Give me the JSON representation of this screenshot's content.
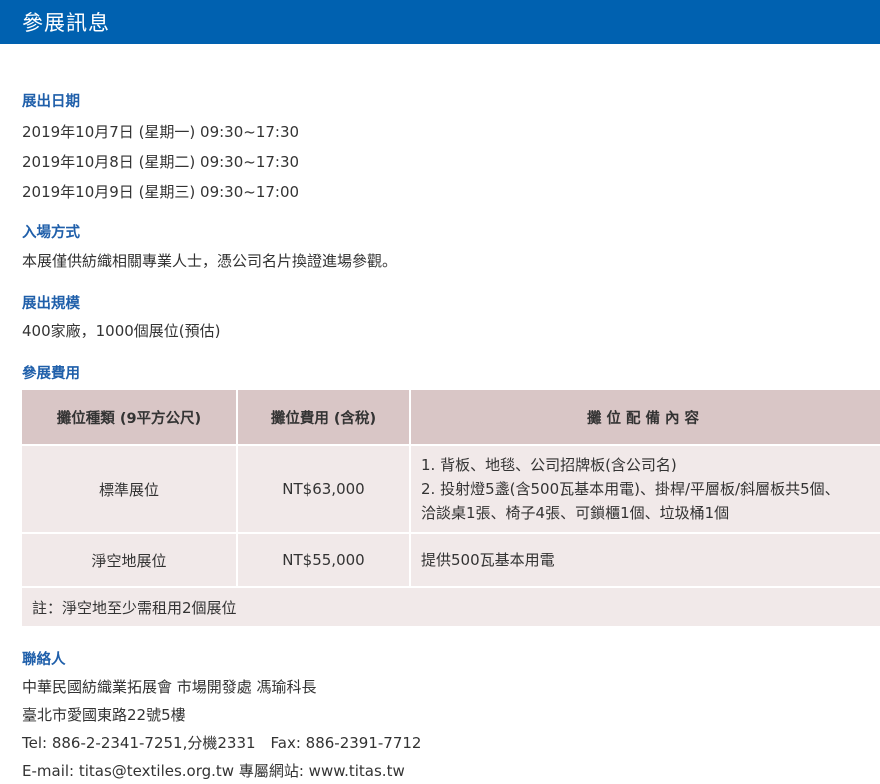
{
  "header": {
    "title": "參展訊息"
  },
  "dates": {
    "title": "展出日期",
    "lines": [
      "2019年10月7日 (星期一) 09:30~17:30",
      "2019年10月8日 (星期二) 09:30~17:30",
      "2019年10月9日 (星期三) 09:30~17:00"
    ]
  },
  "entry": {
    "title": "入場方式",
    "text": "本展僅供紡織相關專業人士，憑公司名片換證進場參觀。"
  },
  "scale": {
    "title": "展出規模",
    "text": "400家廠，1000個展位(預估)"
  },
  "fees": {
    "title": "參展費用",
    "headers": [
      "攤位種類 (9平方公尺)",
      "攤位費用 (含稅)",
      "攤位配備內容"
    ],
    "rows": [
      {
        "type": "標準展位",
        "price": "NT$63,000",
        "items": [
          "1. 背板、地毯、公司招牌板(含公司名)",
          "2. 投射燈5盞(含500瓦基本用電)、掛桿/平層板/斜層板共5個、",
          "洽談桌1張、椅子4張、可鎖櫃1個、垃圾桶1個"
        ]
      },
      {
        "type": "淨空地展位",
        "price": "NT$55,000",
        "items": [
          "提供500瓦基本用電"
        ]
      }
    ],
    "note": "註：淨空地至少需租用2個展位"
  },
  "contact": {
    "title": "聯絡人",
    "org": "中華民國紡織業拓展會 市場開發處 馮瑜科長",
    "address": "臺北市愛國東路22號5樓",
    "tel": "Tel: 886-2-2341-7251,分機2331　Fax: 886-2391-7712",
    "email_prefix": "E-mail: ",
    "email": "titas@textiles.org.tw",
    "site_prefix": " 專屬網站: ",
    "site": "www.titas.tw"
  },
  "colors": {
    "header_bg": "#0061b0",
    "section_title": "#1f5faa",
    "table_head": "#d9c6c6",
    "table_body": "#f1e9e9"
  }
}
